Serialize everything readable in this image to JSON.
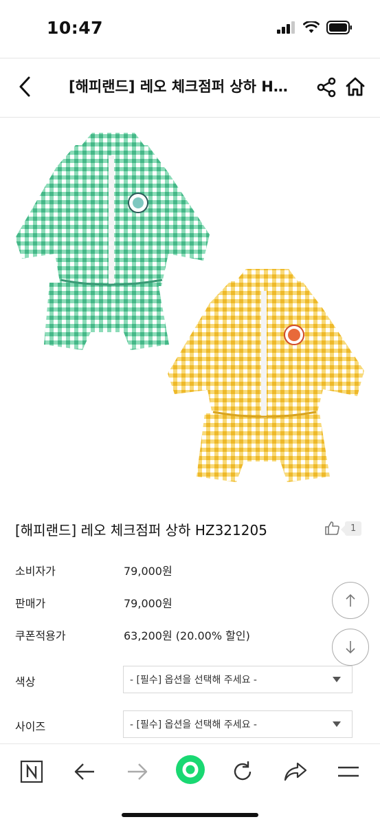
{
  "status_bar": {
    "time": "10:47"
  },
  "header": {
    "title": "[해피랜드] 레오 체크점퍼 상하 HZ321205"
  },
  "product": {
    "title": "[해피랜드] 레오 체크점퍼 상하 HZ321205",
    "like_count": "1",
    "info": [
      {
        "label": "소비자가",
        "value": "79,000원"
      },
      {
        "label": "판매가",
        "value": "79,000원"
      },
      {
        "label": "쿠폰적용가",
        "value": "63,200원 (20.00% 할인)"
      }
    ],
    "options": [
      {
        "label": "색상",
        "placeholder": "- [필수] 옵션을 선택해 주세요 -"
      },
      {
        "label": "사이즈",
        "placeholder": "- [필수] 옵션을 선택해 주세요 -"
      }
    ]
  },
  "colors": {
    "green_check": "#5cc59a",
    "yellow_check": "#f3c63c",
    "accent_green": "#19d872"
  },
  "bottom_bar_icons": [
    "n-logo-icon",
    "back-arrow-icon",
    "forward-arrow-icon",
    "green-circle-icon",
    "reload-icon",
    "share-icon",
    "menu-icon"
  ]
}
